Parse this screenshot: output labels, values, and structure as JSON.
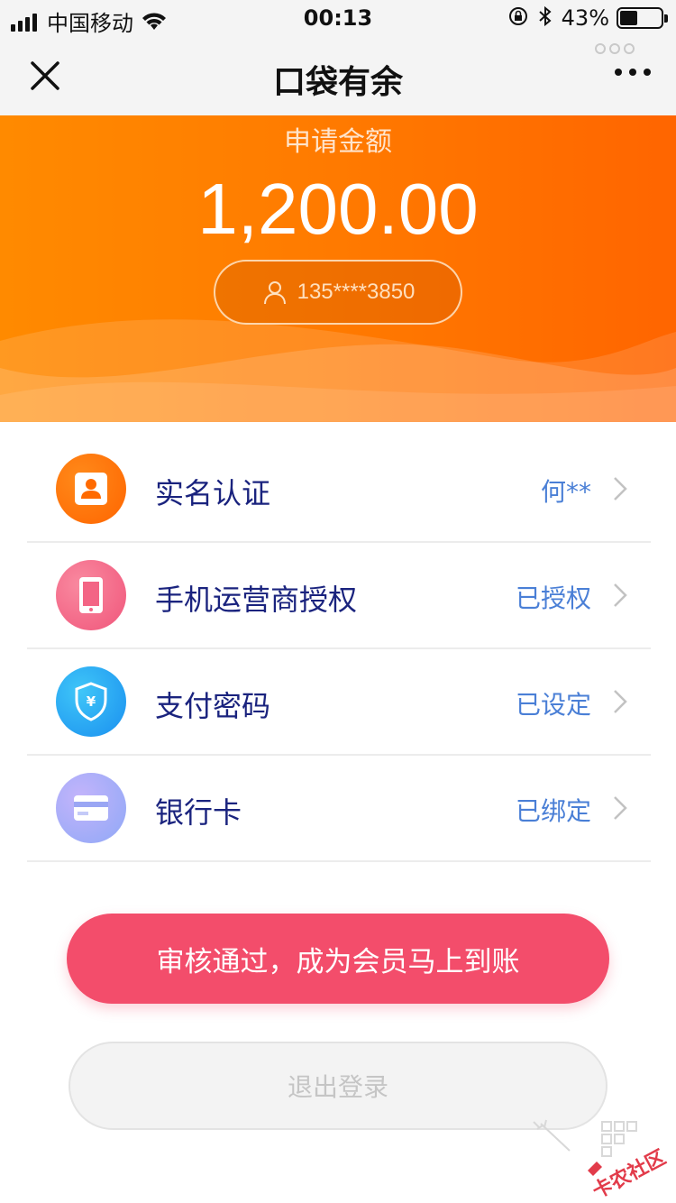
{
  "status_bar": {
    "carrier": "中国移动",
    "time": "00:13",
    "battery_percent": "43%",
    "battery_level": 0.43
  },
  "nav": {
    "title": "口袋有余",
    "close_icon": "close-icon",
    "more_icon": "more-icon"
  },
  "header": {
    "apply_label": "申请金额",
    "amount": "1,200.00",
    "phone": "135****3850",
    "colors": {
      "start": "#ff8a00",
      "end": "#ff6500"
    }
  },
  "items": [
    {
      "label": "实名认证",
      "status": "何**",
      "icon": "id-card-icon",
      "color": "#ff6a00"
    },
    {
      "label": "手机运营商授权",
      "status": "已授权",
      "icon": "mobile-phone-icon",
      "color": "#f36585"
    },
    {
      "label": "支付密码",
      "status": "已设定",
      "icon": "shield-yen-icon",
      "color": "#2196f3"
    },
    {
      "label": "银行卡",
      "status": "已绑定",
      "icon": "bank-card-icon",
      "color": "#a59df5"
    }
  ],
  "actions": {
    "primary": "审核通过，成为会员马上到账",
    "logout": "退出登录"
  },
  "watermark": {
    "text": "卡农社区"
  }
}
